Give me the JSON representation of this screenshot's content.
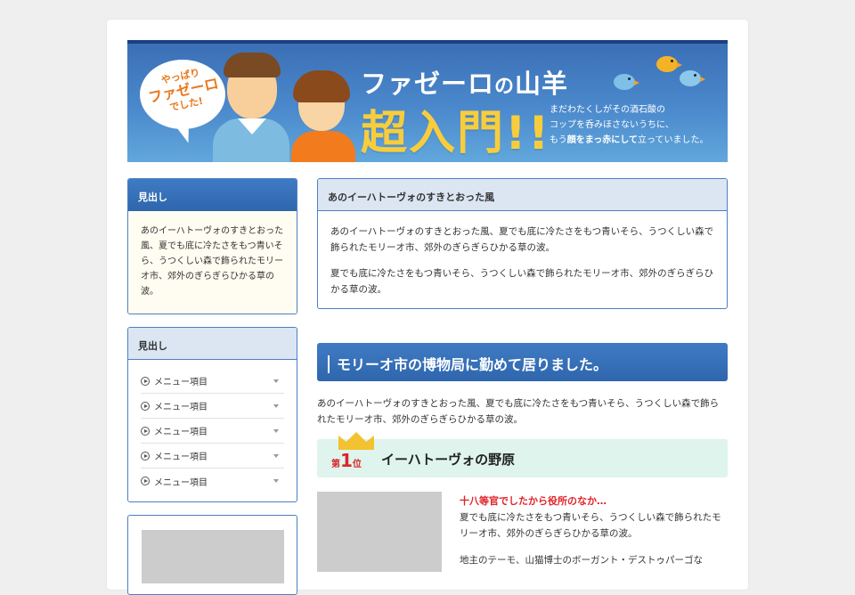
{
  "banner": {
    "bubble_line1": "やっぱり",
    "bubble_line2": "ファゼーロ",
    "bubble_line3": "でした!",
    "title_part1": "ファゼーロ",
    "title_part2": "の",
    "title_part3": "山羊",
    "subtitle": "超入門!!",
    "desc_line1": "まだわたくしがその酒石酸の",
    "desc_line2": "コップを呑みほさないうちに、",
    "desc_line3_pre": "もう",
    "desc_line3_bold": "顔をまっ赤にして",
    "desc_line3_post": "立っていました。"
  },
  "sidebar": {
    "box1": {
      "heading": "見出し",
      "text": "あのイーハトーヴォのすきとおった風、夏でも底に冷たさをもつ青いそら、うつくしい森で飾られたモリーオ市、郊外のぎらぎらひかる草の波。"
    },
    "box2": {
      "heading": "見出し",
      "items": [
        {
          "label": "メニュー項目"
        },
        {
          "label": "メニュー項目"
        },
        {
          "label": "メニュー項目"
        },
        {
          "label": "メニュー項目"
        },
        {
          "label": "メニュー項目"
        }
      ]
    }
  },
  "main": {
    "box": {
      "heading": "あのイーハトーヴォのすきとおった風",
      "p1": "あのイーハトーヴォのすきとおった風、夏でも底に冷たさをもつ青いそら、うつくしい森で飾られたモリーオ市、郊外のぎらぎらひかる草の波。",
      "p2": "夏でも底に冷たさをもつ青いそら、うつくしい森で飾られたモリーオ市、郊外のぎらぎらひかる草の波。"
    },
    "h2": "モリーオ市の博物局に勤めて居りました。",
    "paragraph": "あのイーハトーヴォのすきとおった風、夏でも底に冷たさをもつ青いそら、うつくしい森で飾られたモリーオ市、郊外のぎらぎらひかる草の波。",
    "rank": {
      "prefix": "第",
      "number": "1",
      "suffix": "位",
      "title": "イーハトーヴォの野原"
    },
    "item": {
      "title": "十八等官でしたから役所のなか…",
      "desc": "夏でも底に冷たさをもつ青いそら、うつくしい森で飾られたモリーオ市、郊外のぎらぎらひかる草の波。",
      "desc2": "地主のテーモ、山猫博士のボーガント・デストゥパーゴな"
    }
  },
  "colors": {
    "primary_blue": "#3b72bd",
    "accent_yellow": "#f8cd3c",
    "rank_red": "#e0242a",
    "rank_bg": "#def4ec",
    "cream_bg": "#fffdf1"
  }
}
